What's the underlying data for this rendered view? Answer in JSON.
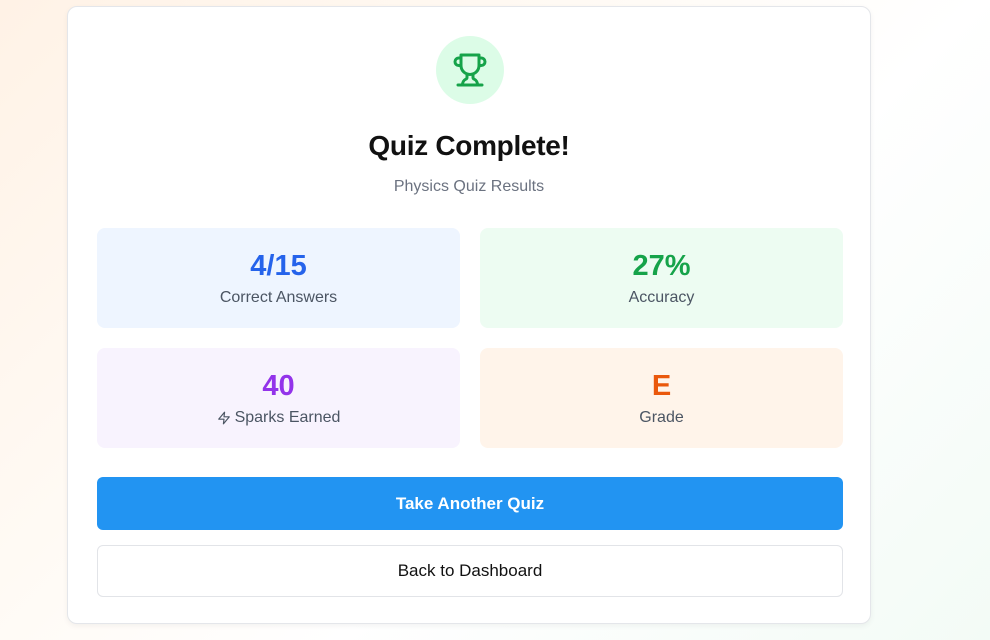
{
  "header": {
    "icon": "trophy-icon",
    "title": "Quiz Complete!",
    "subtitle": "Physics Quiz Results"
  },
  "stats": {
    "correct": {
      "value": "4/15",
      "label": "Correct Answers",
      "color": "#2563eb"
    },
    "accuracy": {
      "value": "27%",
      "label": "Accuracy",
      "color": "#16a34a"
    },
    "sparks": {
      "value": "40",
      "label": "Sparks Earned",
      "icon": "lightning-bolt-icon",
      "color": "#9333ea"
    },
    "grade": {
      "value": "E",
      "label": "Grade",
      "color": "#ea580c"
    }
  },
  "actions": {
    "primary_label": "Take Another Quiz",
    "secondary_label": "Back to Dashboard",
    "primary_color": "#2294f2"
  }
}
